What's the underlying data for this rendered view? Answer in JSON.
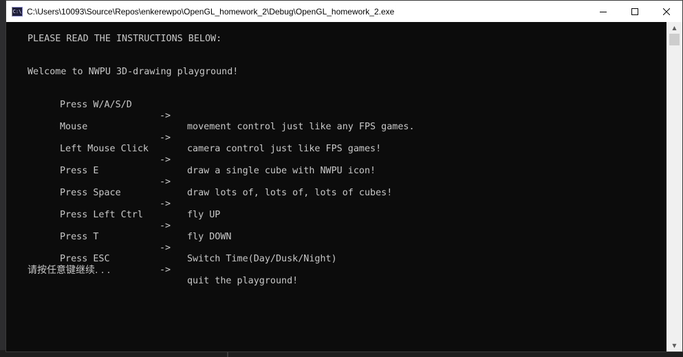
{
  "window": {
    "title": "C:\\Users\\10093\\Source\\Repos\\enkerewpo\\OpenGL_homework_2\\Debug\\OpenGL_homework_2.exe",
    "icon_text": "C:\\",
    "icon": "console-app-icon",
    "minimize_icon": "minimize-icon",
    "maximize_icon": "maximize-icon",
    "close_icon": "close-icon"
  },
  "console": {
    "header": "PLEASE READ THE INSTRUCTIONS BELOW:",
    "welcome": "Welcome to NWPU 3D-drawing playground!",
    "instructions": [
      {
        "key": "Press W/A/S/D",
        "arrow": "->",
        "desc": "movement control just like any FPS games."
      },
      {
        "key": "Mouse",
        "arrow": "->",
        "desc": "camera control just like FPS games!"
      },
      {
        "key": "Left Mouse Click",
        "arrow": "->",
        "desc": "draw a single cube with NWPU icon!"
      },
      {
        "key": "Press E",
        "arrow": "->",
        "desc": "draw lots of, lots of, lots of cubes!"
      },
      {
        "key": "Press Space",
        "arrow": "->",
        "desc": "fly UP"
      },
      {
        "key": "Press Left Ctrl",
        "arrow": "->",
        "desc": "fly DOWN"
      },
      {
        "key": "Press T",
        "arrow": "->",
        "desc": "Switch Time(Day/Dusk/Night)"
      },
      {
        "key": "Press ESC",
        "arrow": "->",
        "desc": "quit the playground!"
      }
    ],
    "prompt": "请按任意键继续. . ."
  },
  "colors": {
    "console_bg": "#0c0c0c",
    "console_text": "#c8c8c8",
    "titlebar_bg": "#ffffff"
  }
}
